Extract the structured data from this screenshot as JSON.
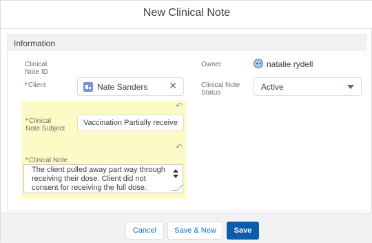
{
  "modal": {
    "title": "New Clinical Note",
    "section_title": "Information"
  },
  "fields": {
    "clinical_note_id_label": "Clinical Note ID",
    "client_label": "Client",
    "client_value": "Nate Sanders",
    "owner_label": "Owner",
    "owner_value": "natalie rydell",
    "status_label": "Clinical Note Status",
    "status_value": "Active",
    "subject_label": "Clinical Note Subject",
    "subject_value": "Vaccination Partially receive",
    "note_label": "Clinical Note",
    "note_value": "The client pulled away part way through receiving their dose. Client did not consent for receiving the full dose."
  },
  "required_marker": "*",
  "icons": {
    "client": "contact-record-icon",
    "owner": "user-avatar-icon",
    "clear": "close-icon",
    "undo": "undo-icon",
    "dropdown": "chevron-down-icon"
  },
  "footer": {
    "cancel": "Cancel",
    "save_new": "Save & New",
    "save": "Save"
  },
  "colors": {
    "primary": "#0b5cab",
    "highlight": "#fdfbc5",
    "required": "#c23934"
  }
}
